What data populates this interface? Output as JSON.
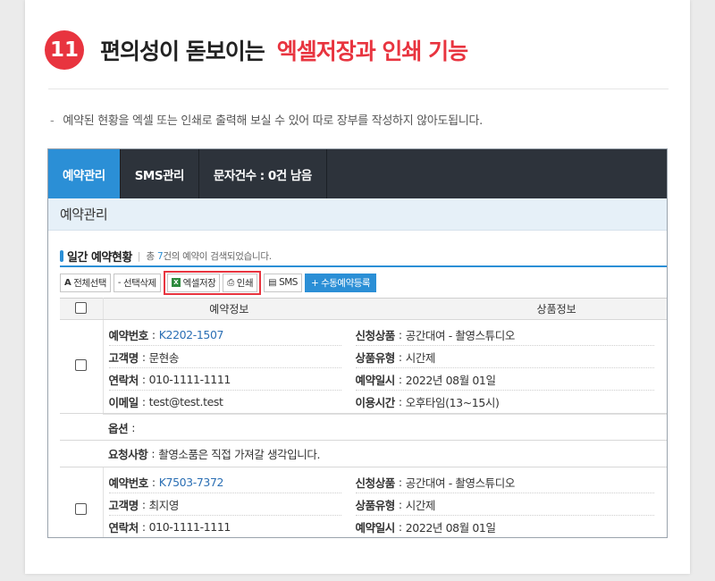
{
  "heading": {
    "number": "11",
    "title": "편의성이 돋보이는",
    "accent": "엑셀저장과 인쇄 기능",
    "accent_color": "#e8343f"
  },
  "description": "예약된 현황을 엑셀 또는 인쇄로 출력해 보실 수 있어 따로 장부를 작성하지 않아도됩니다.",
  "app": {
    "tabs": [
      {
        "label": "예약관리",
        "active": true
      },
      {
        "label": "SMS관리",
        "active": false
      },
      {
        "label": "문자건수 : 0건 남음",
        "active": false
      }
    ],
    "section_title": "예약관리",
    "list_title": "일간 예약현황",
    "count_prefix": "총",
    "count": "7",
    "count_suffix": "건의 예약이 검색되었습니다.",
    "toolbar": {
      "select_all": "전체선택",
      "delete_selected": "선택삭제",
      "excel": "엑셀저장",
      "print": "인쇄",
      "sms": "SMS",
      "manual_add": "+ 수동예약등록"
    },
    "columns": {
      "reservation_info": "예약정보",
      "product_info": "상품정보"
    },
    "labels": {
      "res_no": "예약번호",
      "customer": "고객명",
      "contact": "연락처",
      "email": "이메일",
      "product": "신청상품",
      "type": "상품유형",
      "date": "예약일시",
      "time": "이용시간",
      "option": "옵션",
      "request": "요청사항"
    },
    "records": [
      {
        "res_no": "K2202-1507",
        "customer": "문현송",
        "contact": "010-1111-1111",
        "email": "test@test.test",
        "product": "공간대여 - 촬영스튜디오",
        "type": "시간제",
        "date": "2022년 08월 01일",
        "time": "오후타임(13~15시)",
        "option": "",
        "request": "촬영소품은 직접 가져갈 생각입니다."
      },
      {
        "res_no": "K7503-7372",
        "customer": "최지영",
        "contact": "010-1111-1111",
        "product": "공간대여 - 촬영스튜디오",
        "type": "시간제",
        "date": "2022년 08월 01일"
      }
    ],
    "accent_color": "#2b8fd6",
    "nav_color": "#2d333b"
  }
}
